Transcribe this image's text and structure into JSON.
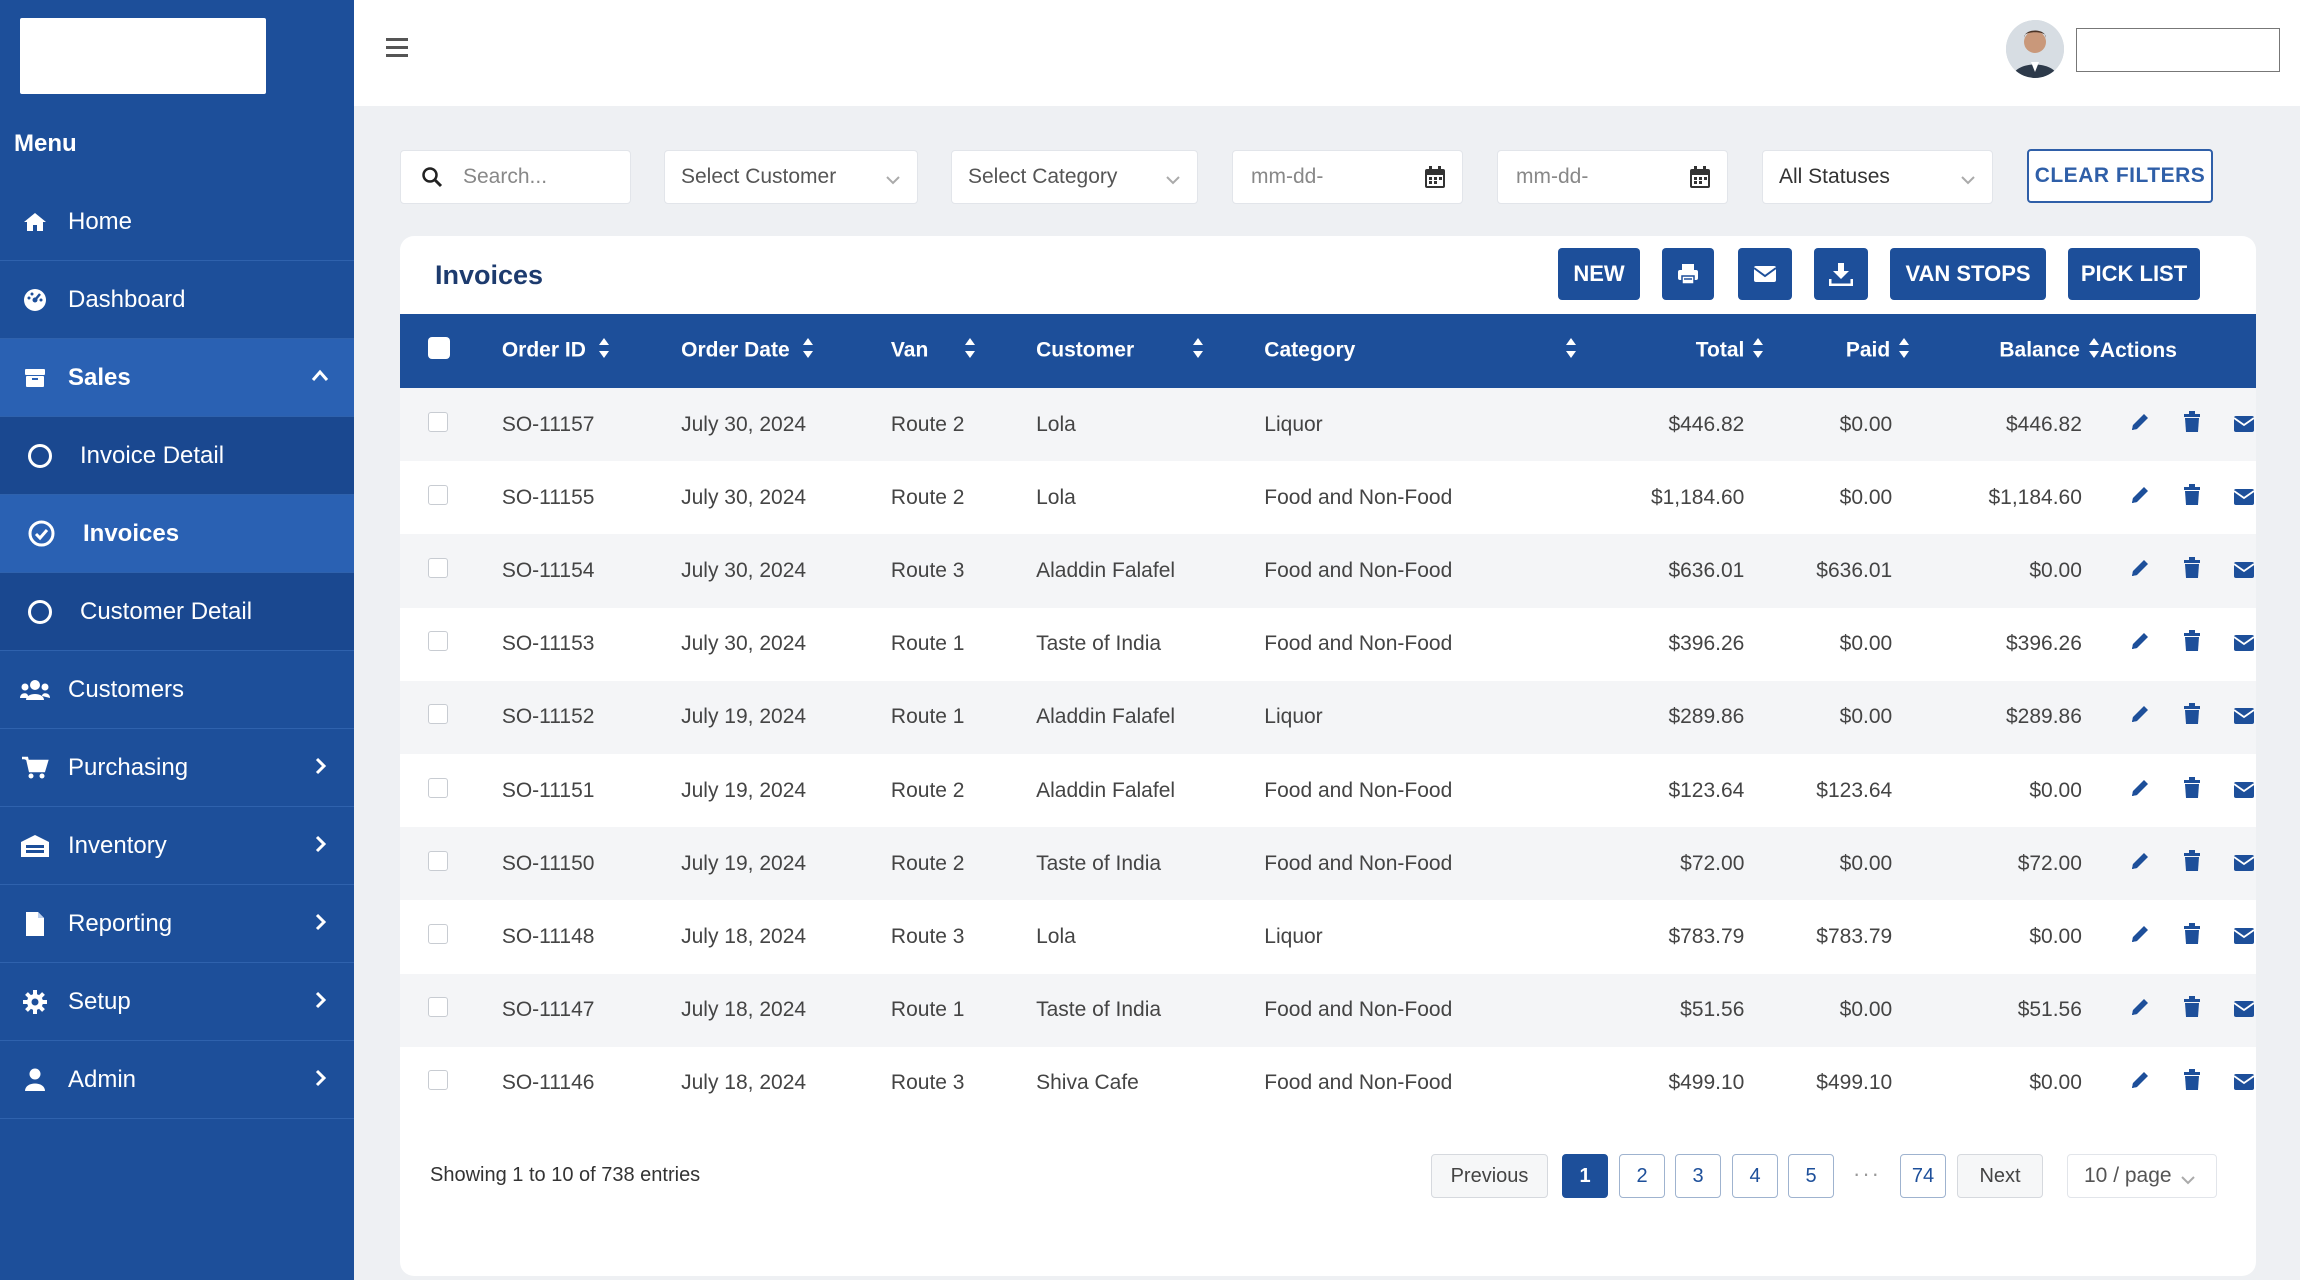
{
  "sidebar": {
    "menu_title": "Menu",
    "items": [
      {
        "label": "Home",
        "icon": "home-icon"
      },
      {
        "label": "Dashboard",
        "icon": "dashboard-icon"
      },
      {
        "label": "Sales",
        "icon": "sales-icon",
        "expanded": true
      },
      {
        "label": "Invoice Detail",
        "icon": "circle-icon"
      },
      {
        "label": "Invoices",
        "icon": "check-circle-icon",
        "active": true
      },
      {
        "label": "Customer Detail",
        "icon": "circle-icon"
      },
      {
        "label": "Customers",
        "icon": "users-icon"
      },
      {
        "label": "Purchasing",
        "icon": "cart-icon"
      },
      {
        "label": "Inventory",
        "icon": "warehouse-icon"
      },
      {
        "label": "Reporting",
        "icon": "file-icon"
      },
      {
        "label": "Setup",
        "icon": "gear-icon"
      },
      {
        "label": "Admin",
        "icon": "user-icon"
      }
    ]
  },
  "filters": {
    "search_placeholder": "Search...",
    "customer": "Select Customer",
    "category": "Select Category",
    "date_from": "mm-dd-",
    "date_to": "mm-dd-",
    "status": "All Statuses",
    "clear_label": "CLEAR FILTERS"
  },
  "card": {
    "title": "Invoices",
    "new_label": "NEW",
    "van_stops_label": "VAN STOPS",
    "pick_list_label": "PICK LIST"
  },
  "table": {
    "headers": {
      "order_id": "Order ID",
      "order_date": "Order Date",
      "van": "Van",
      "customer": "Customer",
      "category": "Category",
      "total": "Total",
      "paid": "Paid",
      "balance": "Balance",
      "actions": "Actions"
    },
    "rows": [
      {
        "order_id": "SO-11157",
        "order_date": "July 30, 2024",
        "van": "Route 2",
        "customer": "Lola",
        "category": "Liquor",
        "total": "$446.82",
        "paid": "$0.00",
        "balance": "$446.82"
      },
      {
        "order_id": "SO-11155",
        "order_date": "July 30, 2024",
        "van": "Route 2",
        "customer": "Lola",
        "category": "Food and Non-Food",
        "total": "$1,184.60",
        "paid": "$0.00",
        "balance": "$1,184.60"
      },
      {
        "order_id": "SO-11154",
        "order_date": "July 30, 2024",
        "van": "Route 3",
        "customer": "Aladdin Falafel",
        "category": "Food and Non-Food",
        "total": "$636.01",
        "paid": "$636.01",
        "balance": "$0.00"
      },
      {
        "order_id": "SO-11153",
        "order_date": "July 30, 2024",
        "van": "Route 1",
        "customer": "Taste of India",
        "category": "Food and Non-Food",
        "total": "$396.26",
        "paid": "$0.00",
        "balance": "$396.26"
      },
      {
        "order_id": "SO-11152",
        "order_date": "July 19, 2024",
        "van": "Route 1",
        "customer": "Aladdin Falafel",
        "category": "Liquor",
        "total": "$289.86",
        "paid": "$0.00",
        "balance": "$289.86"
      },
      {
        "order_id": "SO-11151",
        "order_date": "July 19, 2024",
        "van": "Route 2",
        "customer": "Aladdin Falafel",
        "category": "Food and Non-Food",
        "total": "$123.64",
        "paid": "$123.64",
        "balance": "$0.00"
      },
      {
        "order_id": "SO-11150",
        "order_date": "July 19, 2024",
        "van": "Route 2",
        "customer": "Taste of India",
        "category": "Food and Non-Food",
        "total": "$72.00",
        "paid": "$0.00",
        "balance": "$72.00"
      },
      {
        "order_id": "SO-11148",
        "order_date": "July 18, 2024",
        "van": "Route 3",
        "customer": "Lola",
        "category": "Liquor",
        "total": "$783.79",
        "paid": "$783.79",
        "balance": "$0.00"
      },
      {
        "order_id": "SO-11147",
        "order_date": "July 18, 2024",
        "van": "Route 1",
        "customer": "Taste of India",
        "category": "Food and Non-Food",
        "total": "$51.56",
        "paid": "$0.00",
        "balance": "$51.56"
      },
      {
        "order_id": "SO-11146",
        "order_date": "July 18, 2024",
        "van": "Route 3",
        "customer": "Shiva Cafe",
        "category": "Food and Non-Food",
        "total": "$499.10",
        "paid": "$499.10",
        "balance": "$0.00"
      }
    ]
  },
  "footer": {
    "showing": "Showing 1 to 10 of 738 entries",
    "previous": "Previous",
    "next": "Next",
    "pages": [
      "1",
      "2",
      "3",
      "4",
      "5"
    ],
    "ellipsis": "···",
    "last_page": "74",
    "per_page": "10 / page"
  },
  "colors": {
    "primary": "#1d4f9a",
    "sidebar_active": "#2a61b3"
  }
}
